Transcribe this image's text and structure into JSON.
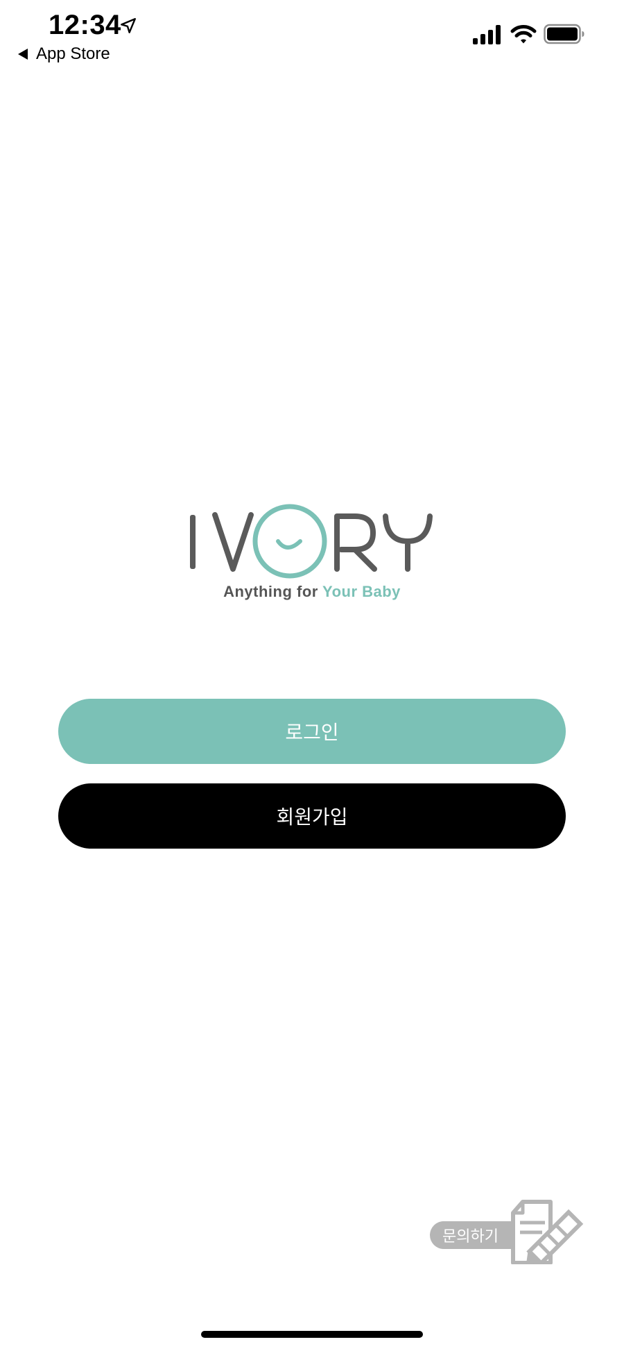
{
  "status_bar": {
    "time": "12:34",
    "back_label": "App Store",
    "icons": [
      "location-arrow-icon",
      "cellular-signal-icon",
      "wifi-icon",
      "battery-icon"
    ]
  },
  "logo": {
    "wordmark": "IVORY",
    "tagline_prefix": "Anything for ",
    "tagline_accent": "Your Baby"
  },
  "buttons": {
    "login_label": "로그인",
    "signup_label": "회원가입"
  },
  "inquiry": {
    "label": "문의하기",
    "icon": "document-pencil-icon"
  },
  "colors": {
    "accent": "#7bc1b6",
    "signup_bg": "#000000",
    "logo_gray": "#555555",
    "inquiry_gray": "#b5b5b5"
  }
}
